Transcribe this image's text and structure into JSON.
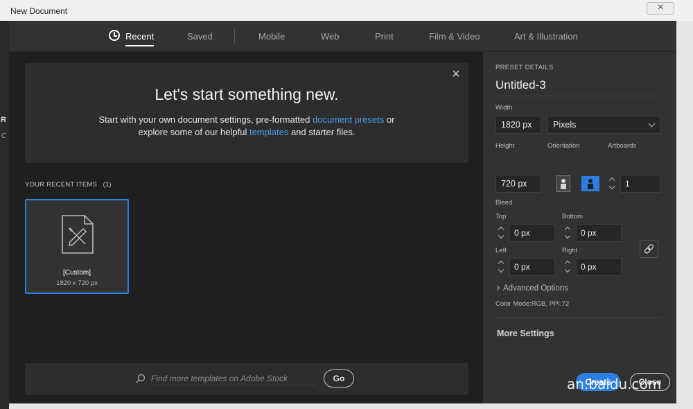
{
  "window": {
    "title": "New Document"
  },
  "behind": {
    "r": "R",
    "c": "C"
  },
  "tabs": [
    {
      "label": "Recent"
    },
    {
      "label": "Saved"
    },
    {
      "label": "Mobile"
    },
    {
      "label": "Web"
    },
    {
      "label": "Print"
    },
    {
      "label": "Film & Video"
    },
    {
      "label": "Art & Illustration"
    }
  ],
  "hero": {
    "title": "Let's start something new.",
    "line1_a": "Start with your own document settings, pre-formatted ",
    "line1_link": "document presets",
    "line1_b": " or",
    "line2_a": "explore some of our helpful ",
    "line2_link": "templates",
    "line2_b": " and starter files."
  },
  "recent": {
    "label": "YOUR RECENT ITEMS",
    "count": "(1)",
    "items": [
      {
        "name": "[Custom]",
        "size": "1820 x 720 px"
      }
    ]
  },
  "stock": {
    "placeholder": "Find more templates on Adobe Stock",
    "go_label": "Go"
  },
  "preset": {
    "header": "PRESET DETAILS",
    "name": "Untitled-3",
    "width_label": "Width",
    "width_value": "1820 px",
    "units": "Pixels",
    "height_label": "Height",
    "height_value": "720 px",
    "orientation_label": "Orientation",
    "artboards_label": "Artboards",
    "artboards_value": "1",
    "bleed_label": "Bleed",
    "top_label": "Top",
    "top_value": "0 px",
    "bottom_label": "Bottom",
    "bottom_value": "0 px",
    "left_label": "Left",
    "left_value": "0 px",
    "right_label": "Right",
    "right_value": "0 px",
    "advanced_label": "Advanced Options",
    "color_mode": "Color Mode:RGB, PPI:72",
    "more_settings": "More Settings",
    "create_label": "Create",
    "close_label": "Close"
  },
  "watermark": "an.baidu.com",
  "colors": {
    "accent": "#2c7ee0",
    "link": "#4c9be8",
    "panel": "#323232",
    "bg": "#1f1f1f"
  }
}
